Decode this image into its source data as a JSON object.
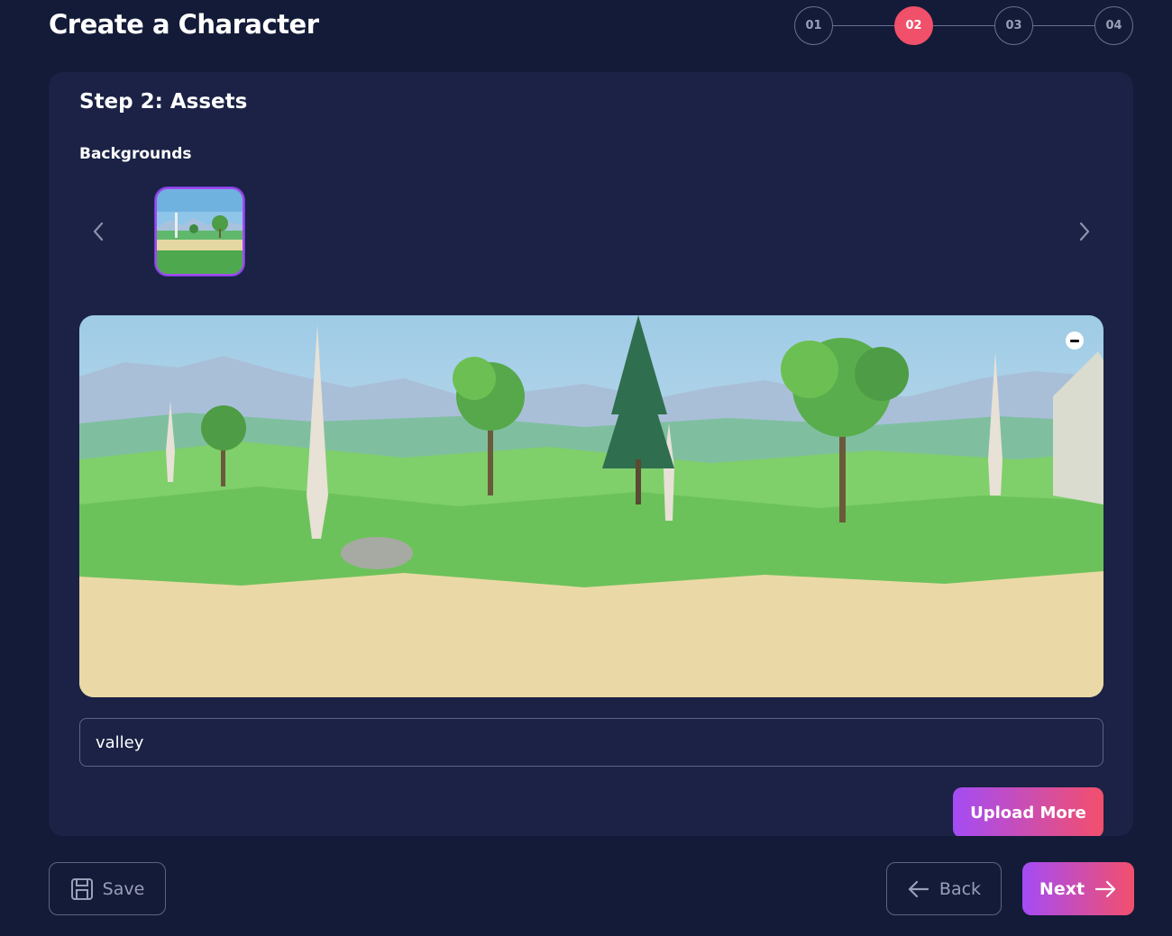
{
  "header": {
    "title": "Create a Character",
    "steps": [
      {
        "label": "01",
        "active": false
      },
      {
        "label": "02",
        "active": true
      },
      {
        "label": "03",
        "active": false
      },
      {
        "label": "04",
        "active": false
      }
    ]
  },
  "card": {
    "title": "Step 2: Assets",
    "section_label": "Backgrounds",
    "prev_icon": "chevron-left-icon",
    "next_icon": "chevron-right-icon",
    "thumbnail_icon": "landscape-thumbnail",
    "remove_icon": "minus-circle-icon",
    "background_name_value": "valley",
    "upload_label": "Upload More"
  },
  "footer": {
    "save_label": "Save",
    "back_label": "Back",
    "next_label": "Next"
  },
  "colors": {
    "page_bg": "#141b38",
    "card_bg": "#1b2245",
    "accent_active_step": "#f0506a",
    "gradient_start": "#a44cf5",
    "gradient_end": "#f34f6c"
  }
}
